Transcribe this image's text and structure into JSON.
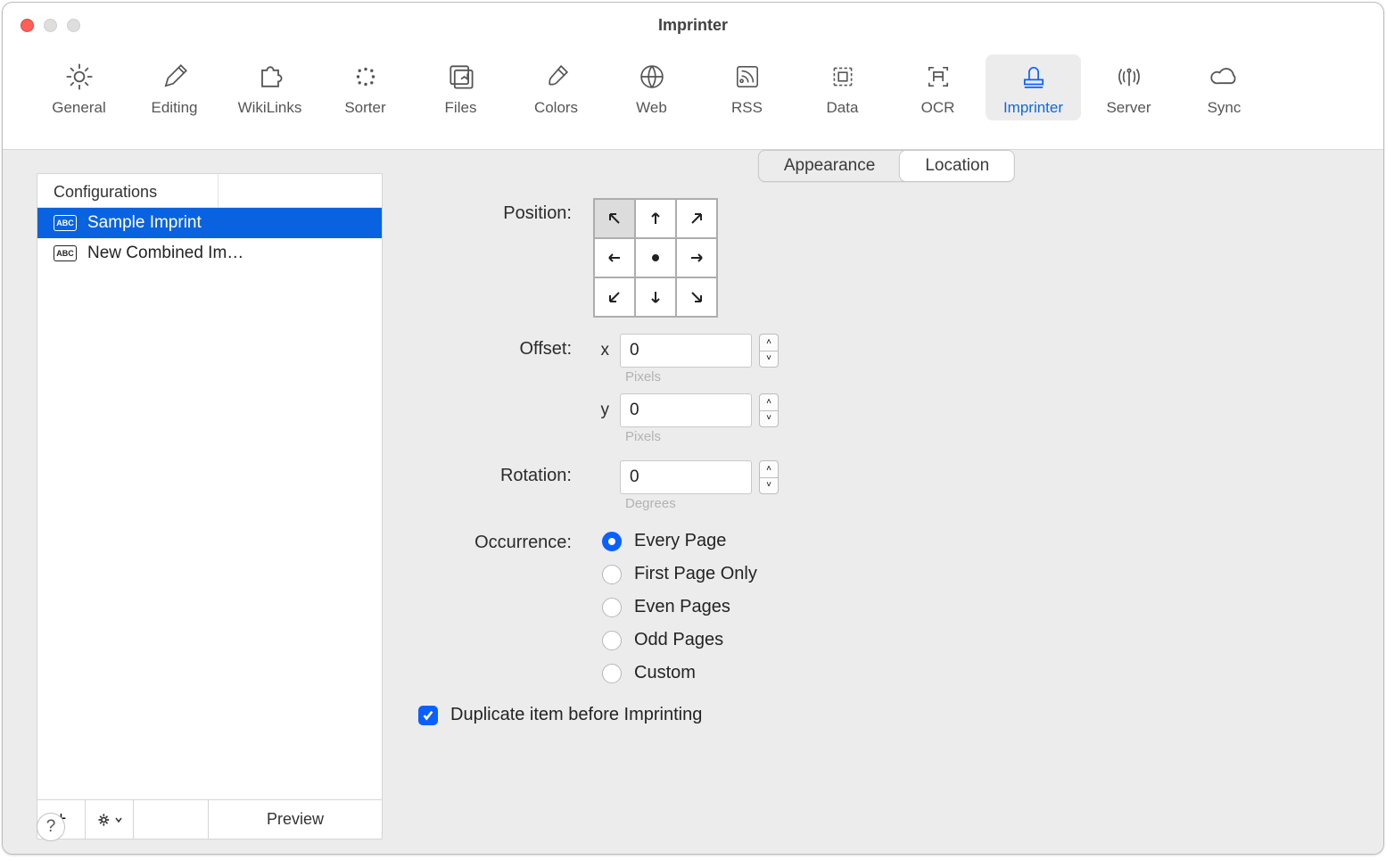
{
  "window": {
    "title": "Imprinter"
  },
  "toolbar": {
    "items": [
      {
        "label": "General"
      },
      {
        "label": "Editing"
      },
      {
        "label": "WikiLinks"
      },
      {
        "label": "Sorter"
      },
      {
        "label": "Files"
      },
      {
        "label": "Colors"
      },
      {
        "label": "Web"
      },
      {
        "label": "RSS"
      },
      {
        "label": "Data"
      },
      {
        "label": "OCR"
      },
      {
        "label": "Imprinter"
      },
      {
        "label": "Server"
      },
      {
        "label": "Sync"
      }
    ],
    "active_index": 10
  },
  "sidebar": {
    "header": "Configurations",
    "items": [
      {
        "label": "Sample Imprint",
        "selected": true
      },
      {
        "label": "New Combined Im…",
        "selected": false
      }
    ],
    "add_label": "+",
    "preview_label": "Preview"
  },
  "subtabs": {
    "items": [
      {
        "label": "Appearance"
      },
      {
        "label": "Location"
      }
    ],
    "active_index": 1
  },
  "form": {
    "position_label": "Position:",
    "position_selected": "top-left",
    "offset_label": "Offset:",
    "offset_x_label": "x",
    "offset_x_value": "0",
    "offset_x_units": "Pixels",
    "offset_y_label": "y",
    "offset_y_value": "0",
    "offset_y_units": "Pixels",
    "rotation_label": "Rotation:",
    "rotation_value": "0",
    "rotation_units": "Degrees",
    "occurrence_label": "Occurrence:",
    "occurrence_options": [
      "Every Page",
      "First Page Only",
      "Even Pages",
      "Odd Pages",
      "Custom"
    ],
    "occurrence_selected": 0,
    "duplicate_label": "Duplicate item before Imprinting",
    "duplicate_checked": true
  },
  "help_label": "?"
}
